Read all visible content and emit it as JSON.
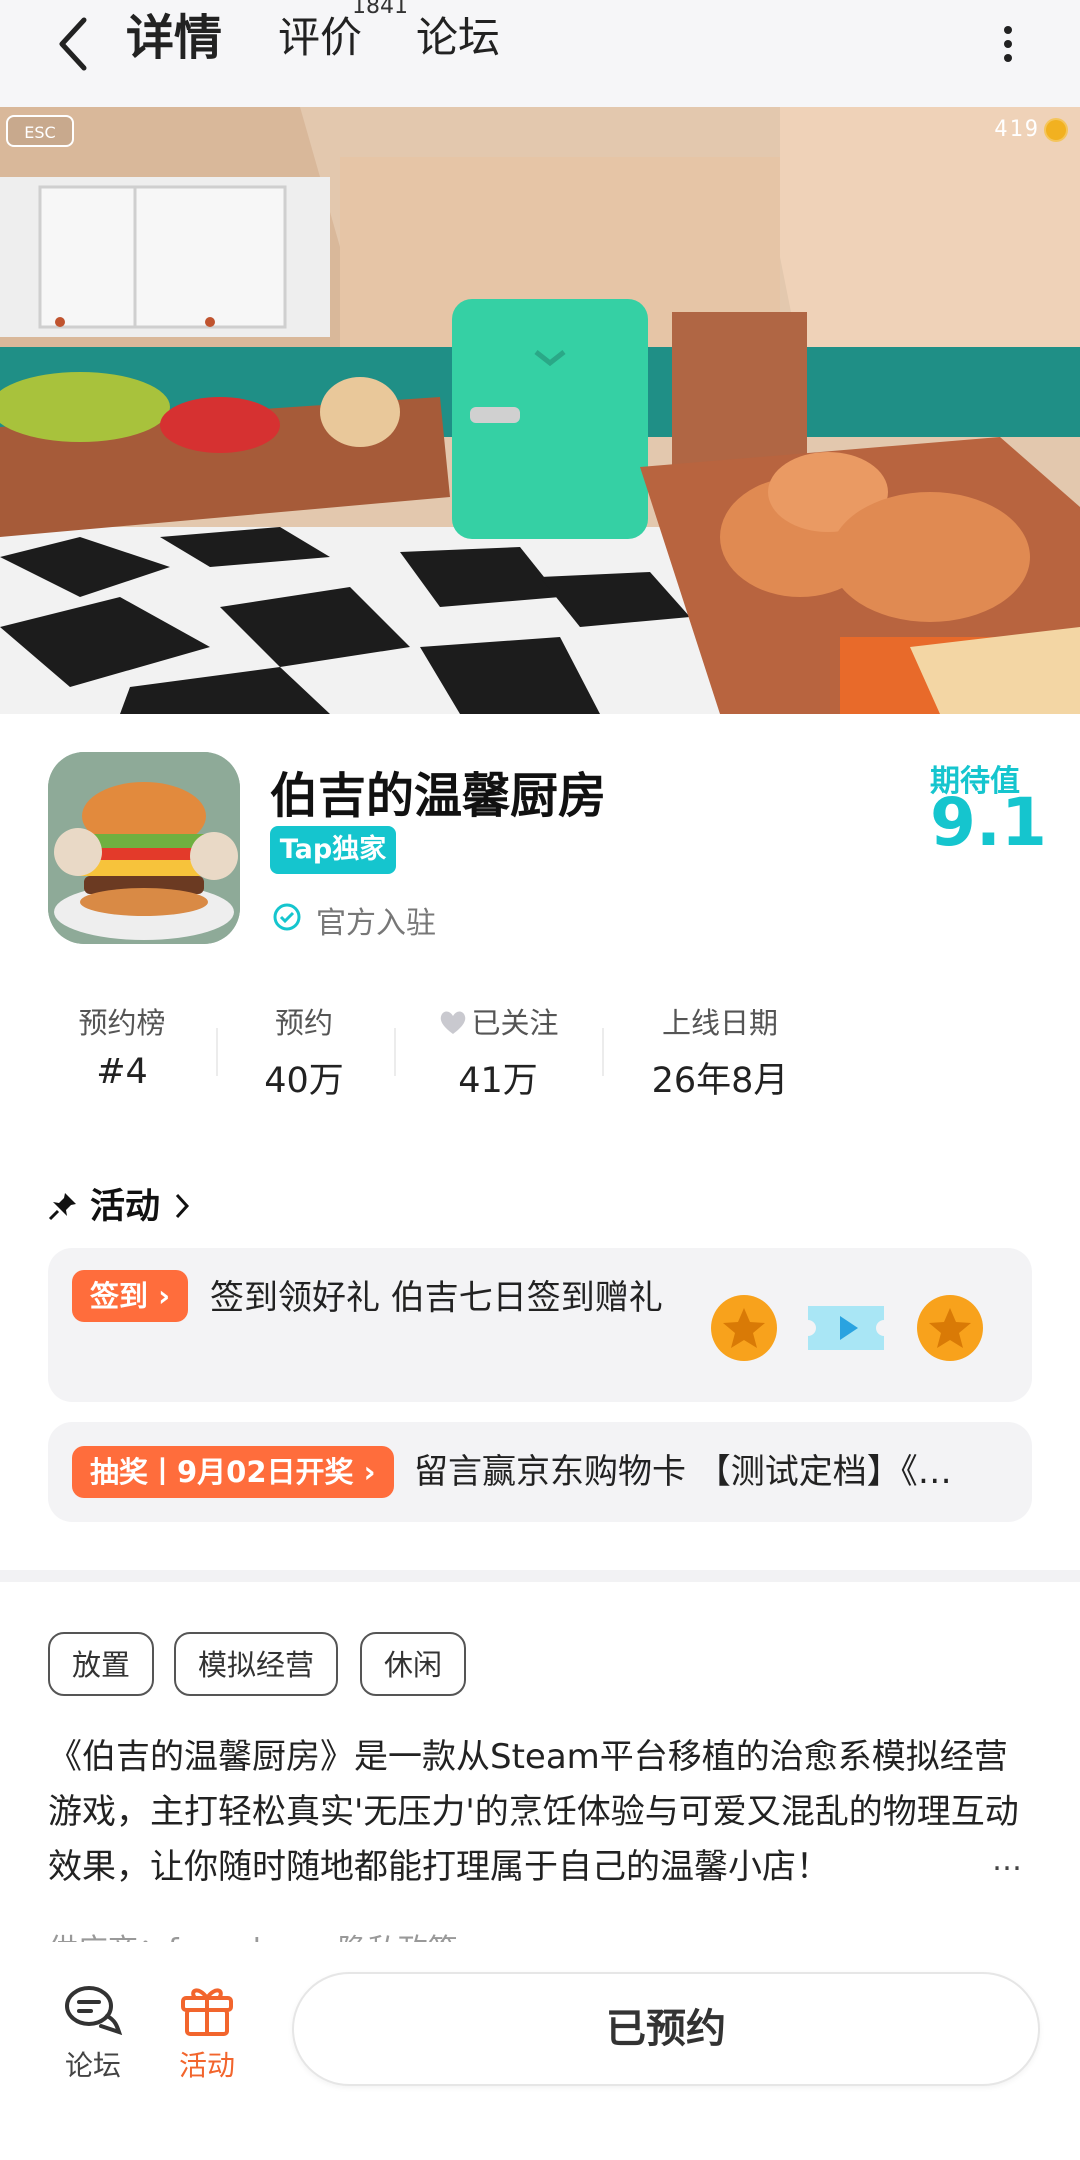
{
  "nav": {
    "tab_detail": "详情",
    "tab_review": "评价",
    "review_count": "1841",
    "tab_forum": "论坛"
  },
  "hero": {
    "esc_label": "ESC",
    "coin_count": "419"
  },
  "game": {
    "title": "伯吉的温馨厨房",
    "badge": "Tap独家",
    "verified": "官方入驻",
    "expect_label": "期待值",
    "expect_score": "9.1"
  },
  "stats": [
    {
      "label": "预约榜",
      "value": "#4"
    },
    {
      "label": "预约",
      "value": "40万"
    },
    {
      "label": "已关注",
      "value": "41万"
    },
    {
      "label": "上线日期",
      "value": "26年8月"
    }
  ],
  "activity": {
    "title": "活动",
    "card1_pill": "签到 ›",
    "card1_text": "签到领好礼 伯吉七日签到赠礼",
    "card2_pill": "抽奖丨9月02日开奖 ›",
    "card2_text": "留言赢京东购物卡 【测试定档】《…"
  },
  "tags": [
    "放置",
    "模拟经营",
    "休闲"
  ],
  "description": "《伯吉的温馨厨房》是一款从Steam平台移植的治愈系模拟经营游戏，主打轻松真实'无压力'的烹饪体验与可爱又混乱的物理互动效果，让你随时随地都能打理属于自己的温馨小店！",
  "description_more": "…",
  "supplier": "供应商：fanyuhang    隐私政策 ›",
  "bottom": {
    "forum": "论坛",
    "activity": "活动",
    "reserve": "已预约"
  },
  "colors": {
    "accent": "#15c5ce",
    "orange": "#ff6d3c",
    "active_tab_orange": "#f2652d"
  }
}
